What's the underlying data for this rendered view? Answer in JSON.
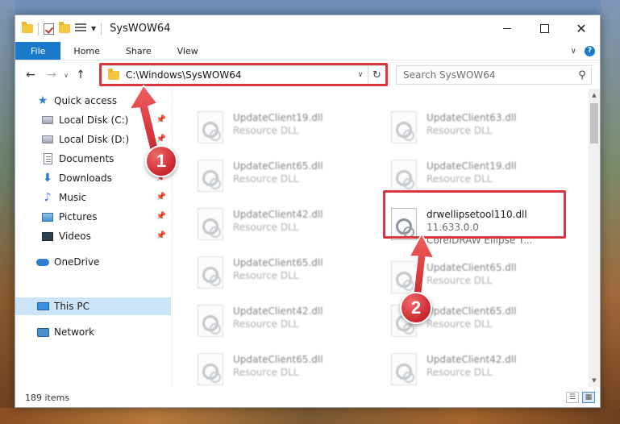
{
  "window": {
    "title": "SysWOW64",
    "minimize_glyph": "",
    "maximize_glyph": "",
    "close_glyph": "✕"
  },
  "ribbon": {
    "tabs": [
      {
        "label": "File",
        "active": true
      },
      {
        "label": "Home"
      },
      {
        "label": "Share"
      },
      {
        "label": "View"
      }
    ]
  },
  "navigation": {
    "back_glyph": "←",
    "forward_glyph": "→",
    "recent_glyph": "∨",
    "up_glyph": "↑",
    "address": "C:\\Windows\\SysWOW64",
    "address_dropdown_glyph": "∨",
    "refresh_glyph": "↻",
    "search_placeholder": "Search SysWOW64",
    "search_glyph": "⚲"
  },
  "sidebar": {
    "items": [
      {
        "label": "Quick access",
        "icon": "star-icon",
        "pinned": false
      },
      {
        "label": "Local Disk (C:)",
        "icon": "disk-icon",
        "pinned": true
      },
      {
        "label": "Local Disk (D:)",
        "icon": "disk-icon",
        "pinned": true
      },
      {
        "label": "Documents",
        "icon": "documents-icon",
        "pinned": true
      },
      {
        "label": "Downloads",
        "icon": "download-icon",
        "pinned": true
      },
      {
        "label": "Music",
        "icon": "music-icon",
        "pinned": true
      },
      {
        "label": "Pictures",
        "icon": "pictures-icon",
        "pinned": true
      },
      {
        "label": "Videos",
        "icon": "videos-icon",
        "pinned": true
      },
      {
        "label": "OneDrive",
        "icon": "onedrive-icon",
        "pinned": false
      },
      {
        "label": "This PC",
        "icon": "pc-icon",
        "pinned": false,
        "selected": true
      },
      {
        "label": "Network",
        "icon": "network-icon",
        "pinned": false
      }
    ]
  },
  "files": [
    {
      "name": "UpdateClient19.dll",
      "type": "Resource DLL",
      "blurred": true
    },
    {
      "name": "UpdateClient63.dll",
      "type": "Resource DLL",
      "blurred": true
    },
    {
      "name": "UpdateClient65.dll",
      "type": "Resource DLL",
      "blurred": true
    },
    {
      "name": "UpdateClient19.dll",
      "type": "Resource DLL",
      "blurred": true
    },
    {
      "name": "UpdateClient42.dll",
      "type": "Resource DLL",
      "blurred": true
    },
    {
      "name": "drwellipsetool110.dll",
      "type": "11.633.0.0",
      "description": "CorelDRAW Ellipse T...",
      "blurred": false
    },
    {
      "name": "UpdateClient65.dll",
      "type": "Resource DLL",
      "blurred": true
    },
    {
      "name": "UpdateClient65.dll",
      "type": "Resource DLL",
      "blurred": true
    },
    {
      "name": "UpdateClient42.dll",
      "type": "Resource DLL",
      "blurred": true
    },
    {
      "name": "UpdateClient65.dll",
      "type": "Resource DLL",
      "blurred": true
    },
    {
      "name": "UpdateClient65.dll",
      "type": "Resource DLL",
      "blurred": true
    },
    {
      "name": "UpdateClient42.dll",
      "type": "Resource DLL",
      "blurred": true
    }
  ],
  "status": {
    "item_count": "189 items"
  },
  "annotations": {
    "step1": "1",
    "step2": "2",
    "color": "#d9363e"
  },
  "colors": {
    "accent": "#1979ca",
    "selection": "#cce4f7",
    "highlight": "#d9363e"
  }
}
